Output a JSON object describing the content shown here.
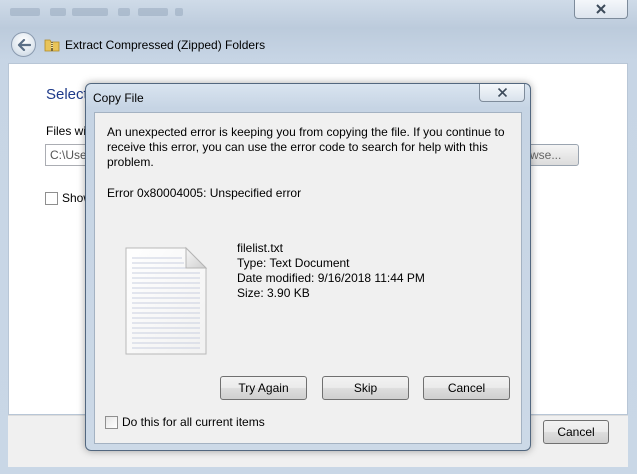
{
  "background_window": {
    "title": "Extract Compressed (Zipped) Folders",
    "heading": "Select",
    "files_label": "Files wi",
    "path_value": "C:\\Use",
    "browse_label": "wse...",
    "show_label": "Show",
    "cancel_label": "Cancel",
    "close_icon": "close-x-icon",
    "back_icon": "back-arrow-icon",
    "folder_icon": "zip-folder-icon"
  },
  "dialog": {
    "title": "Copy File",
    "message": "An unexpected error is keeping you from copying the file. If you continue to receive this error, you can use the error code to search for help with this problem.",
    "error_code": "Error 0x80004005: Unspecified error",
    "file": {
      "name": "filelist.txt",
      "type": "Type: Text Document",
      "date_modified": "Date modified: 9/16/2018 11:44 PM",
      "size": "Size: 3.90 KB",
      "icon": "text-document-icon"
    },
    "buttons": {
      "try_again": "Try Again",
      "skip": "Skip",
      "cancel": "Cancel"
    },
    "checkbox_label": "Do this for all current items",
    "checkbox_checked": false
  }
}
